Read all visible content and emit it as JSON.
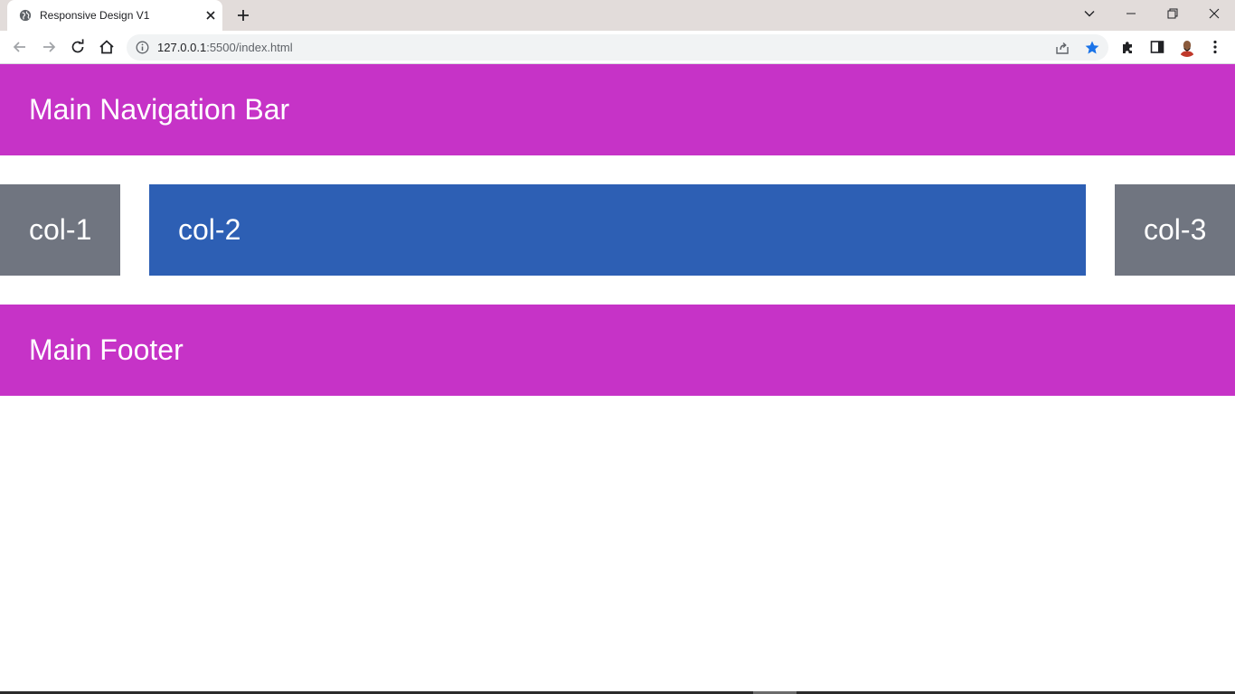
{
  "browser": {
    "tab": {
      "title": "Responsive Design V1",
      "favicon": "globe-icon"
    },
    "address": {
      "host": "127.0.0.1",
      "path": ":5500/index.html"
    },
    "bookmark_starred": true,
    "colors": {
      "titlebar": "#e2dcda",
      "star": "#1a73e8"
    }
  },
  "page": {
    "nav": {
      "label": "Main Navigation Bar"
    },
    "columns": [
      {
        "label": "col-1"
      },
      {
        "label": "col-2"
      },
      {
        "label": "col-3"
      }
    ],
    "footer": {
      "label": "Main Footer"
    },
    "colors": {
      "nav": "#c633c7",
      "side_column": "#707580",
      "main_column": "#2d5fb4",
      "footer": "#c633c7"
    }
  }
}
